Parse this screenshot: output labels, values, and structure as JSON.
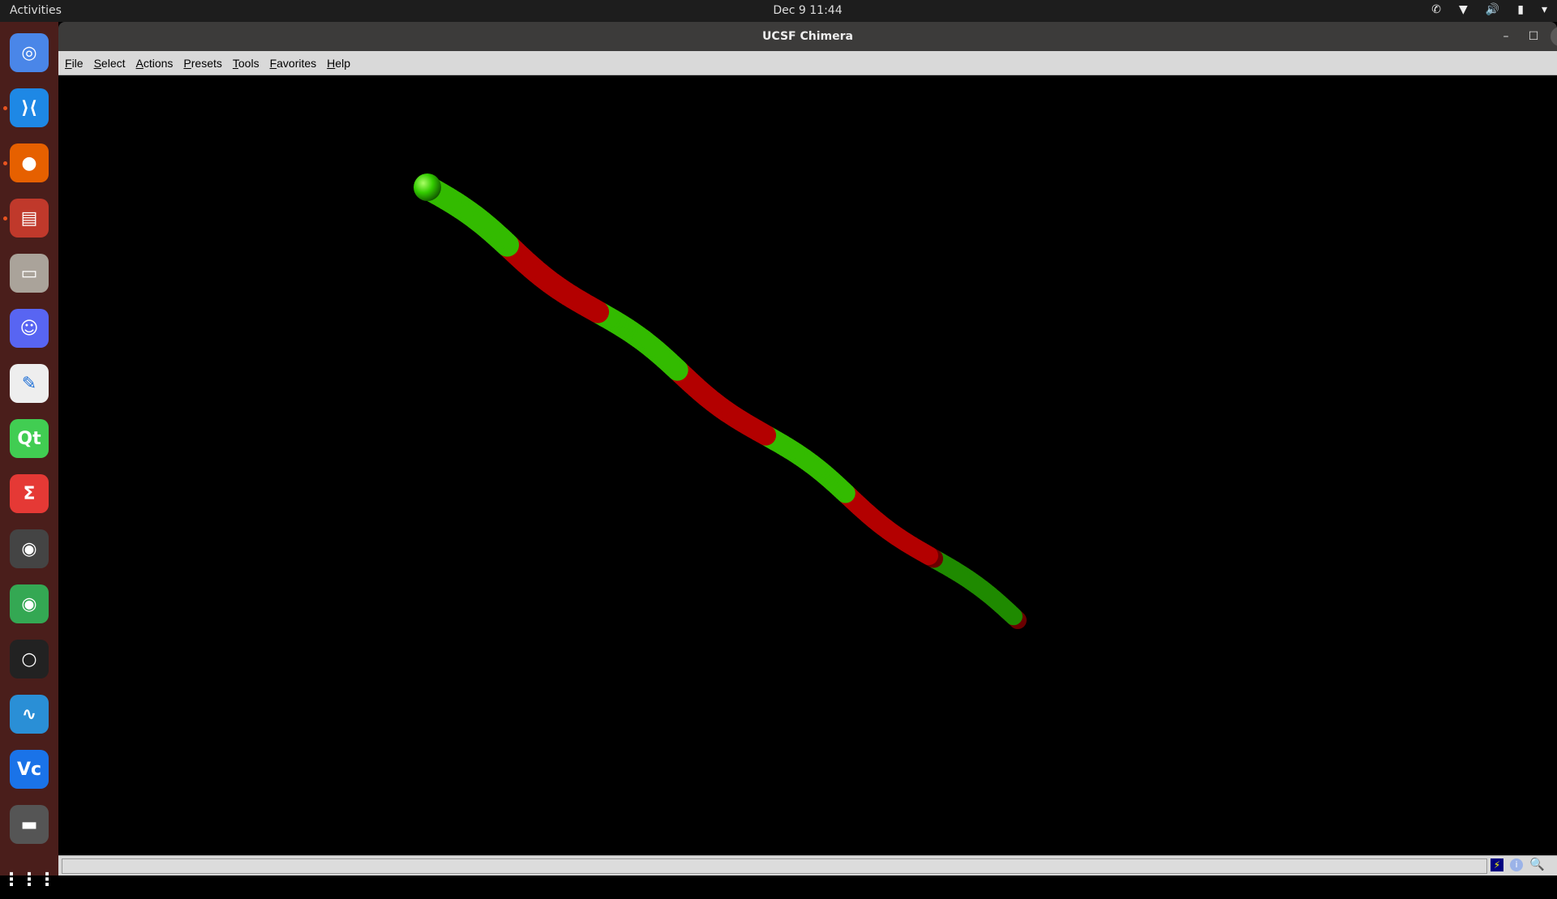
{
  "topbar": {
    "activities": "Activities",
    "clock": "Dec 9  11:44"
  },
  "window": {
    "title": "UCSF Chimera",
    "minimize": "–",
    "maximize": "☐",
    "close": "✕"
  },
  "menu": [
    "File",
    "Select",
    "Actions",
    "Presets",
    "Tools",
    "Favorites",
    "Help"
  ],
  "dock": [
    {
      "name": "chromium",
      "color": "#4a86e8",
      "glyph": "◎"
    },
    {
      "name": "vscode",
      "color": "#1e88e5",
      "glyph": "⟩⟨"
    },
    {
      "name": "firefox",
      "color": "#e66000",
      "glyph": "●"
    },
    {
      "name": "terminal-multiplexer",
      "color": "#c0392b",
      "glyph": "▤"
    },
    {
      "name": "files",
      "color": "#aaa39a",
      "glyph": "▭"
    },
    {
      "name": "discord",
      "color": "#5865f2",
      "glyph": "☺"
    },
    {
      "name": "text-editor",
      "color": "#eeeeee",
      "glyph": "✎"
    },
    {
      "name": "qt-creator",
      "color": "#41cd52",
      "glyph": "Qt"
    },
    {
      "name": "app-red",
      "color": "#e53935",
      "glyph": "Σ"
    },
    {
      "name": "webcam",
      "color": "#444444",
      "glyph": "◉"
    },
    {
      "name": "chrome",
      "color": "#34a853",
      "glyph": "◉"
    },
    {
      "name": "app-ring",
      "color": "#222222",
      "glyph": "○"
    },
    {
      "name": "system-monitor",
      "color": "#2a8fd6",
      "glyph": "∿"
    },
    {
      "name": "vnc",
      "color": "#1a73e8",
      "glyph": "Vc"
    },
    {
      "name": "keyboard",
      "color": "#555555",
      "glyph": "▬"
    },
    {
      "name": "show-apps",
      "color": "transparent",
      "glyph": "⋮⋮⋮"
    }
  ],
  "colors": {
    "helix_green": "#33cc00",
    "helix_red": "#b30000"
  }
}
